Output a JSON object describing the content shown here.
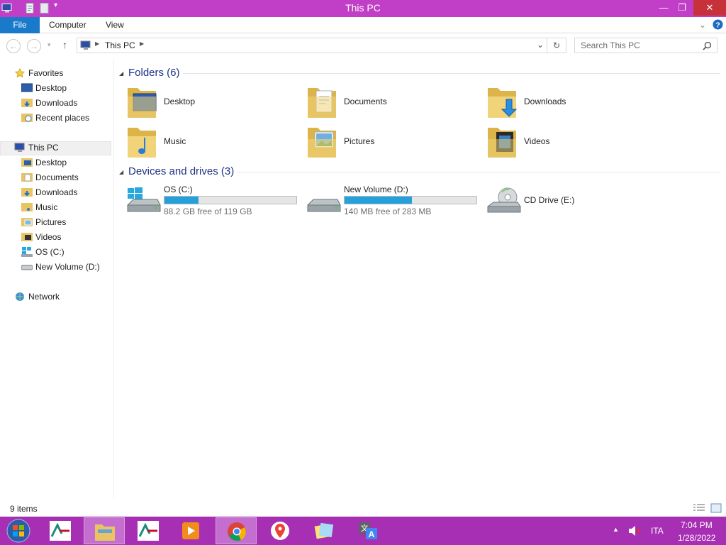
{
  "window": {
    "title": "This PC",
    "controls": {
      "minimize": "—",
      "restore": "❐",
      "close": "✕"
    }
  },
  "ribbon": {
    "tabs": [
      "File",
      "Computer",
      "View"
    ]
  },
  "address": {
    "crumb": "This PC",
    "search_placeholder": "Search This PC"
  },
  "sidebar": {
    "favorites_label": "Favorites",
    "favorites": [
      "Desktop",
      "Downloads",
      "Recent places"
    ],
    "thispc_label": "This PC",
    "thispc": [
      "Desktop",
      "Documents",
      "Downloads",
      "Music",
      "Pictures",
      "Videos",
      "OS (C:)",
      "New Volume (D:)"
    ],
    "network_label": "Network"
  },
  "content": {
    "folders_header": "Folders (6)",
    "folders": [
      "Desktop",
      "Documents",
      "Downloads",
      "Music",
      "Pictures",
      "Videos"
    ],
    "drives_header": "Devices and drives (3)",
    "drives": [
      {
        "name": "OS (C:)",
        "free": "88.2 GB free of 119 GB",
        "used_fraction": 0.26
      },
      {
        "name": "New Volume (D:)",
        "free": "140 MB free of 283 MB",
        "used_fraction": 0.51
      },
      {
        "name": "CD Drive (E:)"
      }
    ]
  },
  "status": {
    "items": "9 items"
  },
  "taskbar": {
    "lang": "ITA",
    "time": "7:04 PM",
    "date": "1/28/2022"
  },
  "colors": {
    "titlebar": "#c13ec6",
    "taskbar": "#a72fb3",
    "accent": "#1979ca",
    "close": "#c7323a",
    "drivebar": "#26a0da"
  }
}
